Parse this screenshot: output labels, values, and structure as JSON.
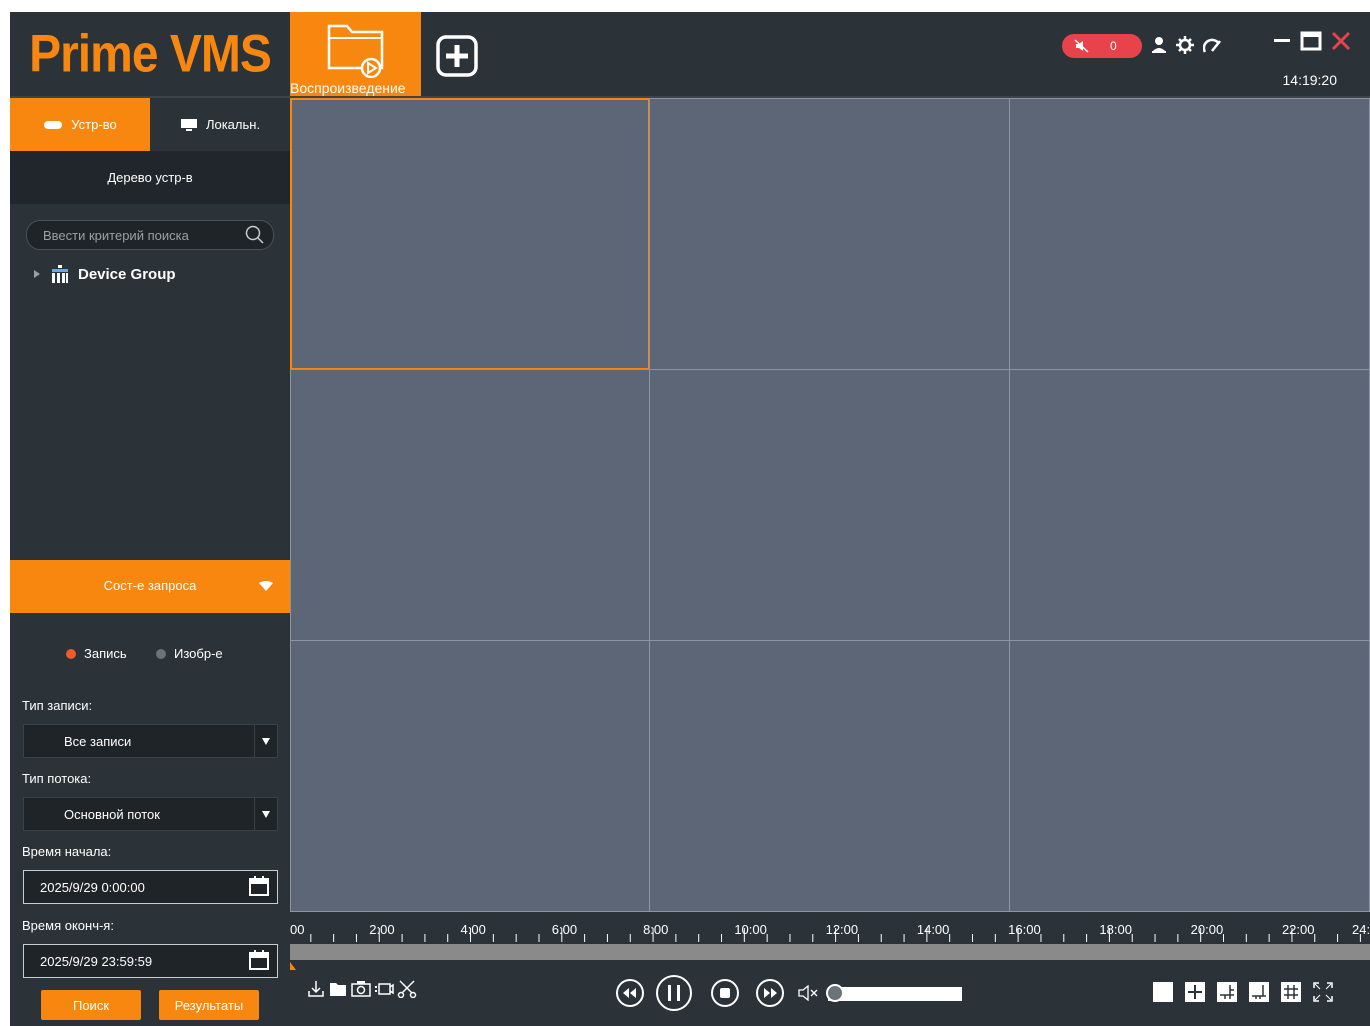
{
  "app": {
    "logo": "Prime VMS"
  },
  "header": {
    "tab_playback": "Воспроизведение",
    "alarm_count": "0",
    "clock": "14:19:20"
  },
  "sidebar": {
    "tab_device": "Устр-во",
    "tab_local": "Локальн.",
    "tree_title": "Дерево устр-в",
    "search_placeholder": "Ввести критерий поиска",
    "tree_items": [
      "Device Group"
    ],
    "query_title": "Сост-е запроса",
    "radio_record": "Запись",
    "radio_image": "Изобр-е",
    "record_type_label": "Тип записи:",
    "record_type_value": "Все записи",
    "stream_type_label": "Тип потока:",
    "stream_type_value": "Основной поток",
    "start_label": "Время начала:",
    "start_value": "2025/9/29 0:00:00",
    "end_label": "Время оконч-я:",
    "end_value": "2025/9/29 23:59:59",
    "search_button": "Поиск",
    "results_button": "Результаты"
  },
  "timeline": {
    "labels": [
      "00",
      "2:00",
      "4:00",
      "6:00",
      "8:00",
      "10:00",
      "12:00",
      "14:00",
      "16:00",
      "18:00",
      "20:00",
      "22:00",
      "24:"
    ]
  },
  "colors": {
    "accent": "#f7870f",
    "background": "#2c3338",
    "video_bg": "#5c6677",
    "alarm": "#e8434a"
  }
}
